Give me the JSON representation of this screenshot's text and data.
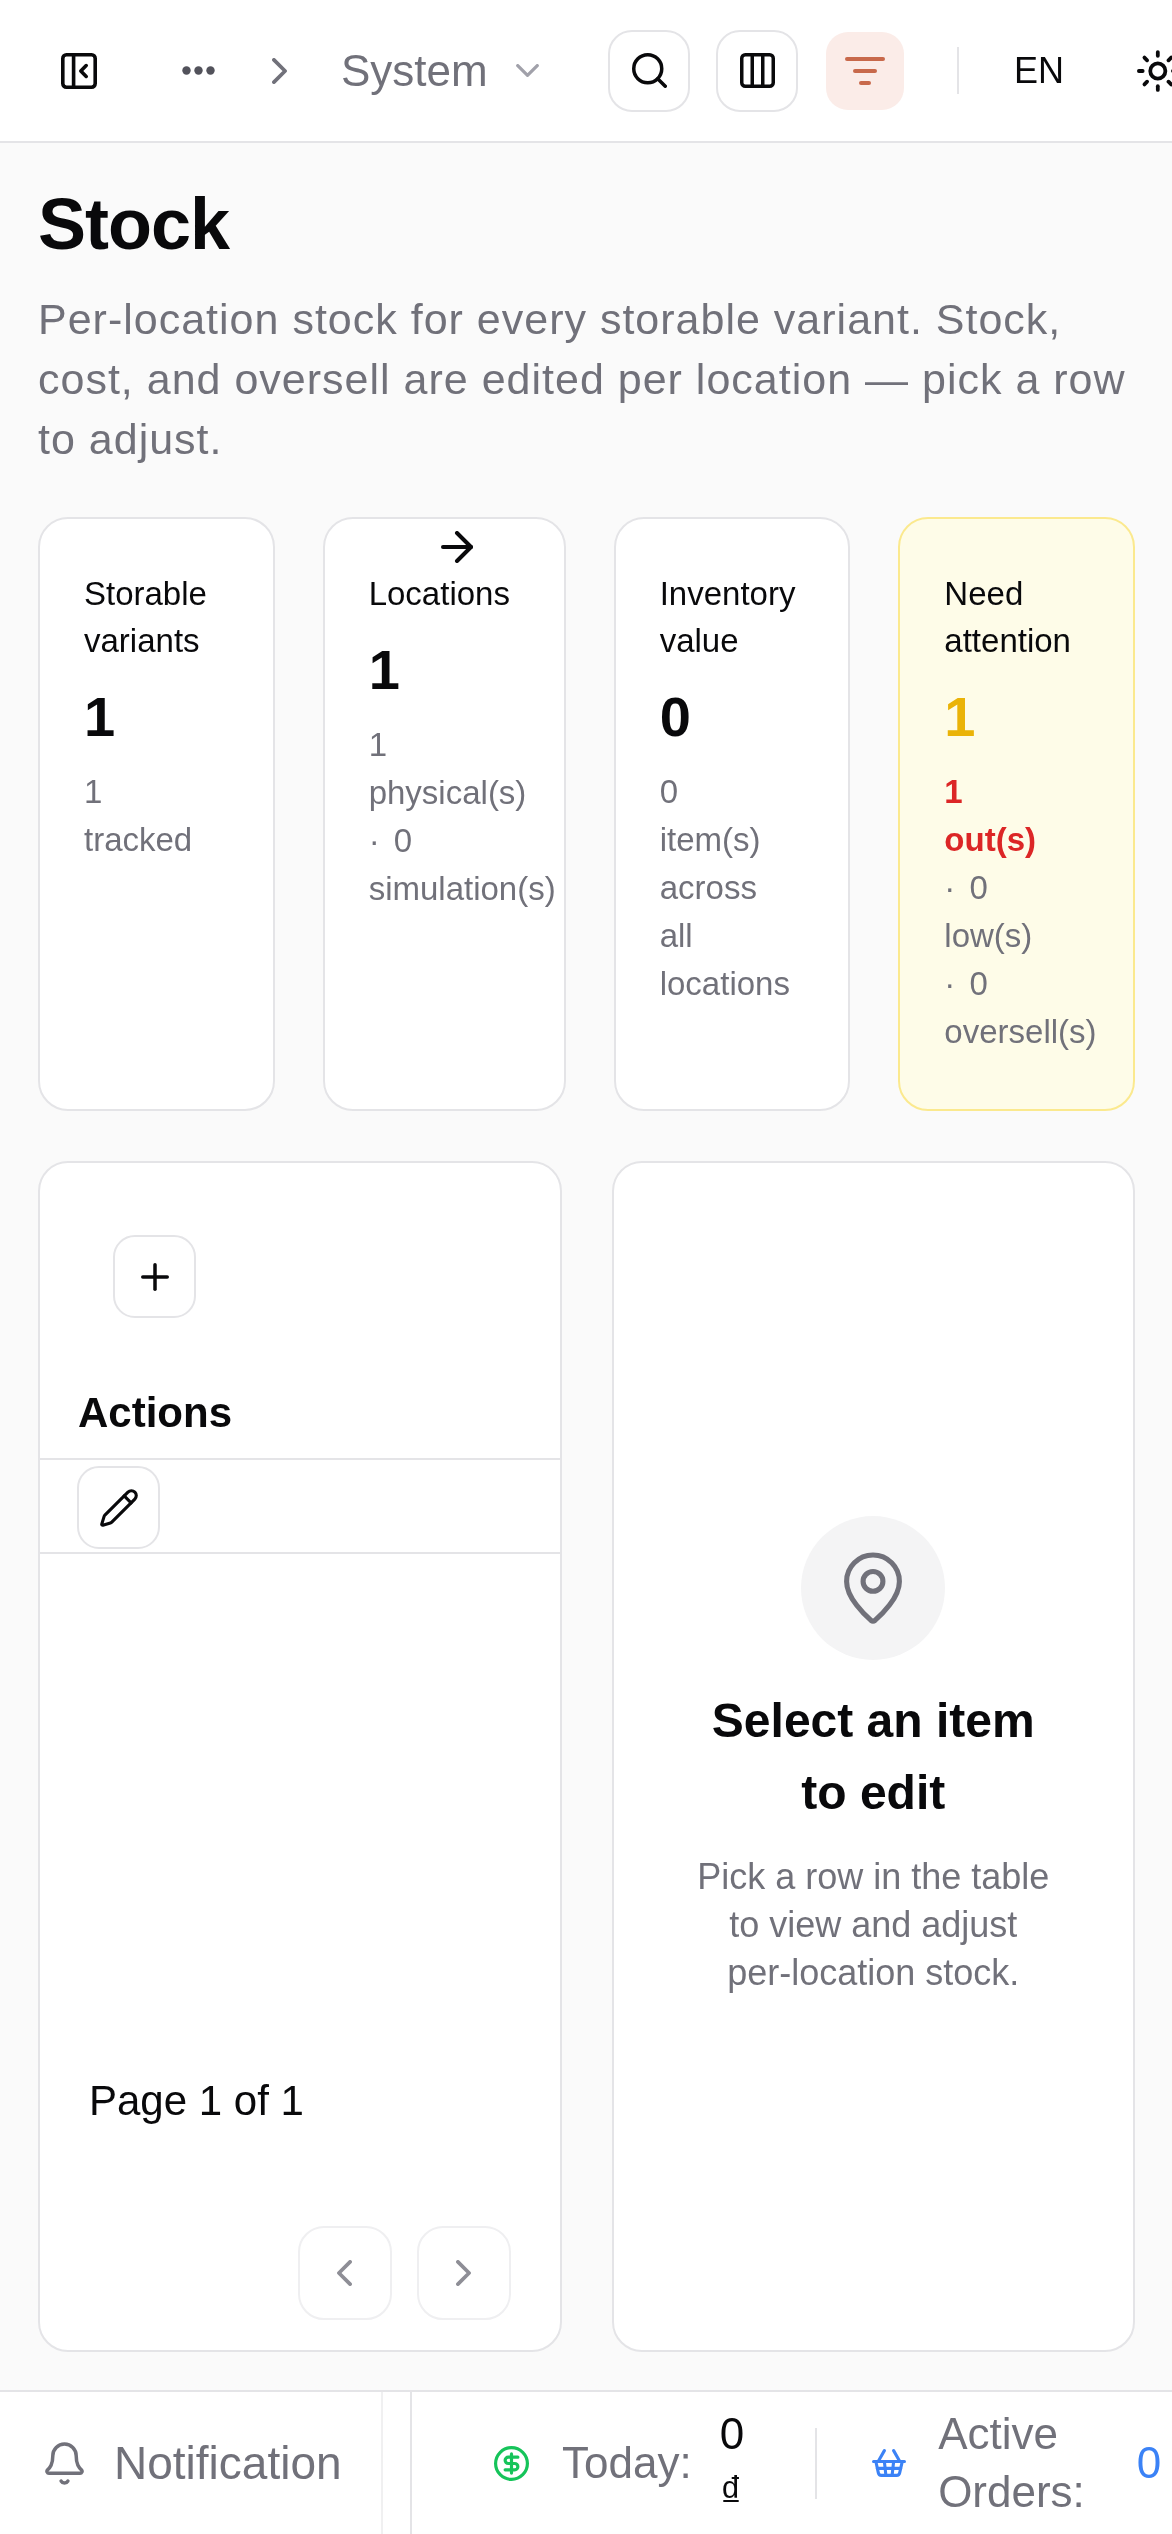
{
  "top_bar": {
    "breadcrumb": {
      "current": "System"
    },
    "toolbar_buttons": [
      {
        "kind": "search",
        "active": false
      },
      {
        "kind": "columns",
        "active": false
      },
      {
        "kind": "filter",
        "active": true
      }
    ],
    "language": "EN"
  },
  "page": {
    "title": "Stock",
    "description": "Per-location stock for every storable variant. Stock, cost, and oversell are edited per location — pick a row to adjust."
  },
  "stats": [
    {
      "kind": "default",
      "link": false,
      "label": "Storable variants",
      "value": "1",
      "details": [
        {
          "kind": "muted",
          "text": "1 tracked"
        }
      ]
    },
    {
      "kind": "default",
      "link": true,
      "label": "Locations",
      "value": "1",
      "details": [
        {
          "kind": "muted",
          "text": "1 physical(s)"
        },
        {
          "kind": "muted",
          "text": "· 0 simulation(s)"
        }
      ]
    },
    {
      "kind": "default",
      "link": false,
      "label": "Inventory value",
      "value": "0",
      "details": [
        {
          "kind": "muted",
          "text": "0 item(s) across all locations"
        }
      ]
    },
    {
      "kind": "warning",
      "link": false,
      "label": "Need attention",
      "value": "1",
      "details": [
        {
          "kind": "danger",
          "text": "1 out(s)"
        },
        {
          "kind": "muted",
          "text": "· 0 low(s)"
        },
        {
          "kind": "muted",
          "text": "· 0 oversell(s)"
        }
      ]
    }
  ],
  "table_panel": {
    "columns": [
      {
        "label": "Actions"
      }
    ],
    "rows": [
      {
        "actions": [
          {
            "kind": "edit"
          }
        ]
      }
    ],
    "pagination": {
      "label": "Page 1 of 1",
      "buttons": [
        {
          "kind": "previous",
          "disabled": true
        },
        {
          "kind": "next",
          "disabled": true
        }
      ]
    }
  },
  "detail_panel": {
    "empty_state": {
      "title": "Select an item to edit",
      "description": "Pick a row in the table to view and adjust per-location stock."
    }
  },
  "bottom_bar": {
    "notification": {
      "label": "Notification"
    },
    "today": {
      "label": "Today:",
      "value": "0 ₫"
    },
    "active_orders": {
      "label": "Active Orders:",
      "value": "0"
    }
  }
}
